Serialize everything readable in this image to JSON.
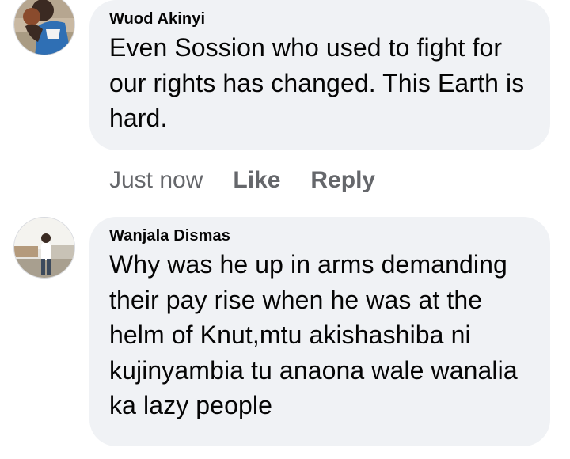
{
  "comments": [
    {
      "author": "Wuod Akinyi",
      "text": "Even  Sossion who used to fight for our rights has changed. This Earth is hard.",
      "time": "Just now",
      "like_label": "Like",
      "reply_label": "Reply"
    },
    {
      "author": "Wanjala Dismas",
      "text": "Why was he up in arms demanding their pay rise when he was at the helm of Knut,mtu akishashiba ni kujinyambia tu anaona wale wanalia ka lazy people"
    }
  ],
  "colors": {
    "bubble": "#f0f2f5",
    "meta_text": "#65676b",
    "body_text": "#050505"
  }
}
